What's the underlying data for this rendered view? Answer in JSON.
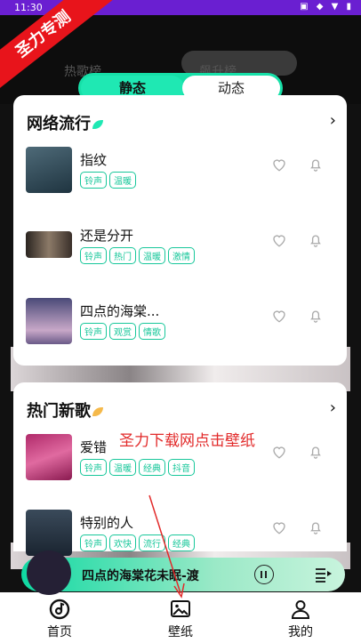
{
  "status": {
    "time": "11:30",
    "icons": "▣ ◆ ▼ ▮"
  },
  "watermark": "圣力专测",
  "ghost_tabs": [
    "热歌榜",
    "飙升榜"
  ],
  "segment": {
    "active": "静态",
    "inactive": "动态"
  },
  "card1": {
    "title": "网络流行",
    "songs": [
      {
        "title": "指纹",
        "tags": [
          "铃声",
          "温暖"
        ]
      },
      {
        "title": "还是分开",
        "tags": [
          "铃声",
          "热门",
          "温暖",
          "激情"
        ]
      },
      {
        "title": "四点的海棠...",
        "tags": [
          "铃声",
          "观赏",
          "情歌"
        ]
      }
    ]
  },
  "card2": {
    "title": "热门新歌",
    "songs": [
      {
        "title": "爱错",
        "tags": [
          "铃声",
          "温暖",
          "经典",
          "抖音"
        ]
      },
      {
        "title": "特别的人",
        "tags": [
          "铃声",
          "欢快",
          "流行",
          "经典"
        ]
      }
    ]
  },
  "promo": "圣力下载网点击壁纸",
  "player": {
    "title": "四点的海棠花未眠-渡"
  },
  "tabbar": [
    {
      "label": "首页"
    },
    {
      "label": "壁纸"
    },
    {
      "label": "我的"
    }
  ],
  "colors": {
    "accent": "#1fe8b3",
    "status_bar": "#6a1fd1",
    "watermark": "#e8141b",
    "promo": "#e22a2a"
  }
}
